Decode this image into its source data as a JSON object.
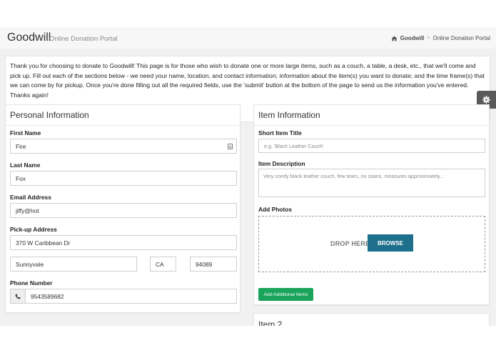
{
  "header": {
    "title": "Goodwill",
    "subtitle": "Online Donation Portal",
    "breadcrumb": [
      "Goodwill",
      "Online Donation Portal"
    ]
  },
  "intro_text": "Thank you for choosing to donate to Goodwill! This page is for those who wish to donate one or more large items, such as a couch, a table, a desk, etc., that we'll come and pick up. Fill out each of the sections below - we need your name, location, and contact information; information about the item(s) you want to donate; and the time frame(s) that we can come by for pickup. Once you're done filling out all the required fields, use the 'submit' button at the bottom of the page to send us the information you've entered. Thanks again!",
  "personal": {
    "heading": "Personal Information",
    "first_name_label": "First Name",
    "first_name": "Fire",
    "last_name_label": "Last Name",
    "last_name": "Fox",
    "email_label": "Email Address",
    "email": "jiffy@hot",
    "address_label": "Pick-up Address",
    "street": "370 W Caribbean Dr",
    "city": "Sunnyvale",
    "state": "CA",
    "zip": "94089",
    "phone_label": "Phone Number",
    "phone": "9543589682"
  },
  "item": {
    "heading": "Item Information",
    "title_label": "Short Item Title",
    "title_placeholder": "e.g. 'Black Leather Couch'",
    "desc_label": "Item Description",
    "desc_placeholder": "Very comfy black leather couch, few tears, no stains, measures approximately...",
    "photos_label": "Add Photos",
    "drop_label": "DROP HERE",
    "browse_label": "BROWSE",
    "add_button": "Add Additional Items"
  },
  "item2": {
    "heading": "Item 2"
  },
  "colors": {
    "browse": "#1d6f8c",
    "add_button": "#1aa35a",
    "gear_tab": "#5a5a5a"
  },
  "icons": [
    "home-icon",
    "gear-icon",
    "phone-icon",
    "contact-card-icon"
  ]
}
